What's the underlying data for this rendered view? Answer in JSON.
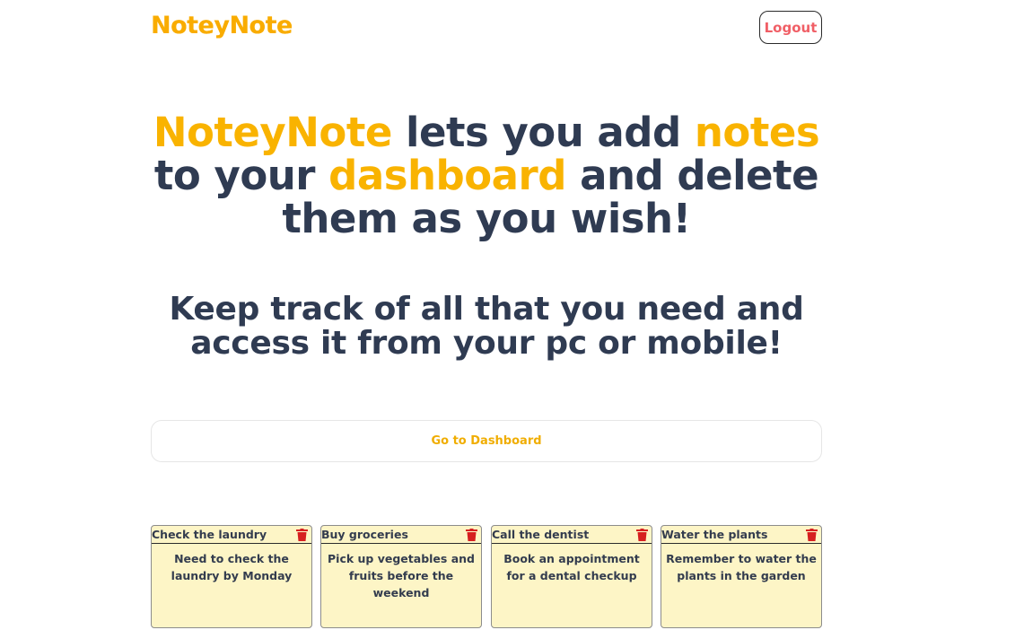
{
  "nav": {
    "brand": "NoteyNote",
    "logout_label": "Logout"
  },
  "hero": {
    "line1_a": "NoteyNote",
    "line1_b": " lets you add ",
    "line1_c": "notes",
    "line2_a": "to your ",
    "line2_b": "dashboard",
    "line2_c": " and delete",
    "line3": "them as you wish!"
  },
  "subheading": {
    "line1": "Keep track of all that you need and",
    "line2": "access it from your pc or mobile!"
  },
  "dashboard_button": {
    "label": "Go to Dashboard"
  },
  "notes": [
    {
      "title": "Check the laundry",
      "body": "Need to check the laundry by Monday",
      "icon": "trash-icon"
    },
    {
      "title": "Buy groceries",
      "body": "Pick up vegetables and fruits before the weekend",
      "icon": "trash-icon"
    },
    {
      "title": "Call the dentist",
      "body": "Book an appointment for a dental checkup",
      "icon": "trash-icon"
    },
    {
      "title": "Water the plants",
      "body": "Remember to water the plants in the garden",
      "icon": "trash-icon"
    }
  ],
  "colors": {
    "accent": "#f9b300",
    "text": "#2f3b52",
    "logout_text": "#f05f66",
    "note_bg": "#fdf5c6",
    "trash": "#d62020"
  }
}
